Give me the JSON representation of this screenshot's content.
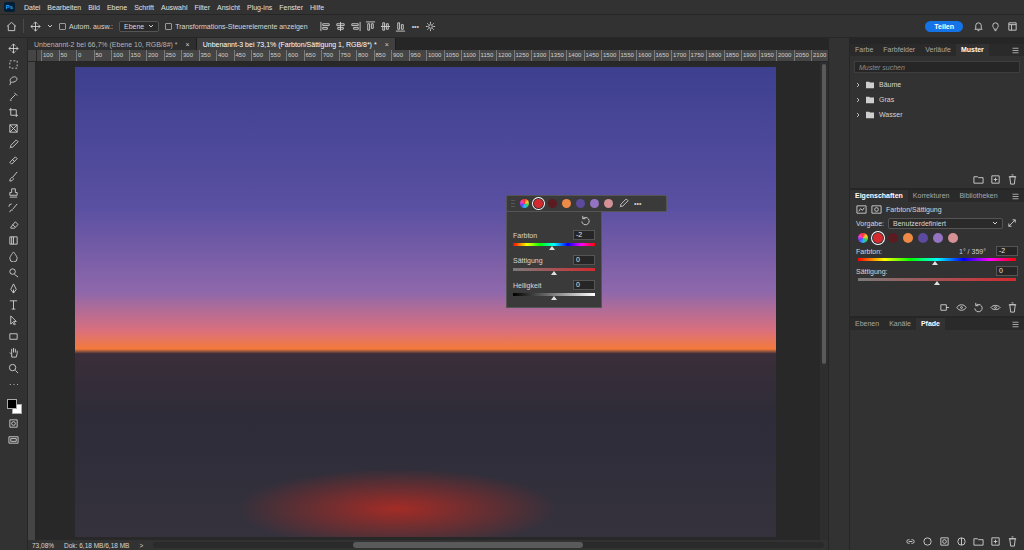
{
  "app_logo": "Ps",
  "menu": [
    "Datei",
    "Bearbeiten",
    "Bild",
    "Ebene",
    "Schrift",
    "Auswahl",
    "Filter",
    "Ansicht",
    "Plug-ins",
    "Fenster",
    "Hilfe"
  ],
  "options_bar": {
    "auto_select": {
      "label": "Autom. ausw.:",
      "checked": false
    },
    "auto_select_target": "Ebene",
    "transform_controls": {
      "label": "Transformations-Steuerelemente anzeigen",
      "checked": false
    },
    "more": "•••",
    "share_button": "Teilen"
  },
  "document_tabs": [
    {
      "label": "Unbenannt-2 bei 66,7% (Ebene 10, RGB/8#) *",
      "close": "×",
      "selected": false
    },
    {
      "label": "Unbenannt-3 bei 73,1% (Farbton/Sättigung 1, RGB/8*) *",
      "close": "×",
      "selected": true
    }
  ],
  "ruler": {
    "labels": [
      "100",
      "50",
      "0",
      "50",
      "100",
      "150",
      "200",
      "250",
      "300",
      "350",
      "400",
      "450",
      "500",
      "550",
      "600",
      "650",
      "700",
      "750",
      "800",
      "850",
      "900",
      "950",
      "1000",
      "1050",
      "1100",
      "1150",
      "1200",
      "1250",
      "1300",
      "1350",
      "1400",
      "1450",
      "1500",
      "1550",
      "1600",
      "1650",
      "1700",
      "1750",
      "1800",
      "1850",
      "1900",
      "1950",
      "2000",
      "2050",
      "2100"
    ]
  },
  "hue_popup": {
    "swatches": [
      {
        "kind": "master",
        "selected": false
      },
      {
        "kind": "channel",
        "color": "#d42a2f",
        "selected": true
      },
      {
        "kind": "channel",
        "color": "#5a1c20",
        "selected": false
      },
      {
        "kind": "channel",
        "color": "#ee8a45",
        "selected": false
      },
      {
        "kind": "channel",
        "color": "#5b4a9e",
        "selected": false
      },
      {
        "kind": "channel",
        "color": "#9373c2",
        "selected": false
      },
      {
        "kind": "channel",
        "color": "#d69196",
        "selected": false
      }
    ],
    "more": "•••",
    "fields": [
      {
        "label": "Farbton",
        "value": "-2",
        "level": 0.48,
        "kind": "hue"
      },
      {
        "label": "Sättigung",
        "value": "0",
        "level": 0.5,
        "kind": "saturation"
      },
      {
        "label": "Helligkeit",
        "value": "0",
        "level": 0.5,
        "kind": "lightness"
      }
    ]
  },
  "status_bar": {
    "zoom": "73,08%",
    "document_size": "Dok: 6,18 MB/6,18 MB",
    "arrow": ">"
  },
  "patterns_panel": {
    "tabs": [
      {
        "label": "Farbe",
        "selected": false
      },
      {
        "label": "Farbfelder",
        "selected": false
      },
      {
        "label": "Verläufe",
        "selected": false
      },
      {
        "label": "Muster",
        "selected": true
      }
    ],
    "search_placeholder": "Muster suchen",
    "folders": [
      {
        "name": "Bäume",
        "expanded": false
      },
      {
        "name": "Gras",
        "expanded": false
      },
      {
        "name": "Wasser",
        "expanded": false
      }
    ]
  },
  "properties_panel": {
    "tabs": [
      {
        "label": "Eigenschaften",
        "selected": true
      },
      {
        "label": "Korrekturen",
        "selected": false
      },
      {
        "label": "Bibliotheken",
        "selected": false
      }
    ],
    "adjustment": "Farbton/Sättigung",
    "preset": {
      "label": "Vorgabe:",
      "value": "Benutzerdefiniert"
    },
    "swatches": [
      {
        "kind": "master",
        "selected": false
      },
      {
        "kind": "channel",
        "color": "#d42a2f",
        "selected": true
      },
      {
        "kind": "channel",
        "color": "#5a1c20",
        "selected": false
      },
      {
        "kind": "channel",
        "color": "#ee8a45",
        "selected": false
      },
      {
        "kind": "channel",
        "color": "#5b4a9e",
        "selected": false
      },
      {
        "kind": "channel",
        "color": "#9373c2",
        "selected": false
      },
      {
        "kind": "channel",
        "color": "#d69196",
        "selected": false
      }
    ],
    "fields": [
      {
        "label": "Farbton:",
        "range": "1° / 359°",
        "value": "-2",
        "level": 0.49,
        "kind": "hue"
      },
      {
        "label": "Sättigung:",
        "value": "0",
        "level": 0.5,
        "kind": "saturation"
      }
    ]
  },
  "layers_panel": {
    "tabs": [
      {
        "label": "Ebenen",
        "selected": false
      },
      {
        "label": "Kanäle",
        "selected": false
      },
      {
        "label": "Pfade",
        "selected": true
      }
    ]
  }
}
